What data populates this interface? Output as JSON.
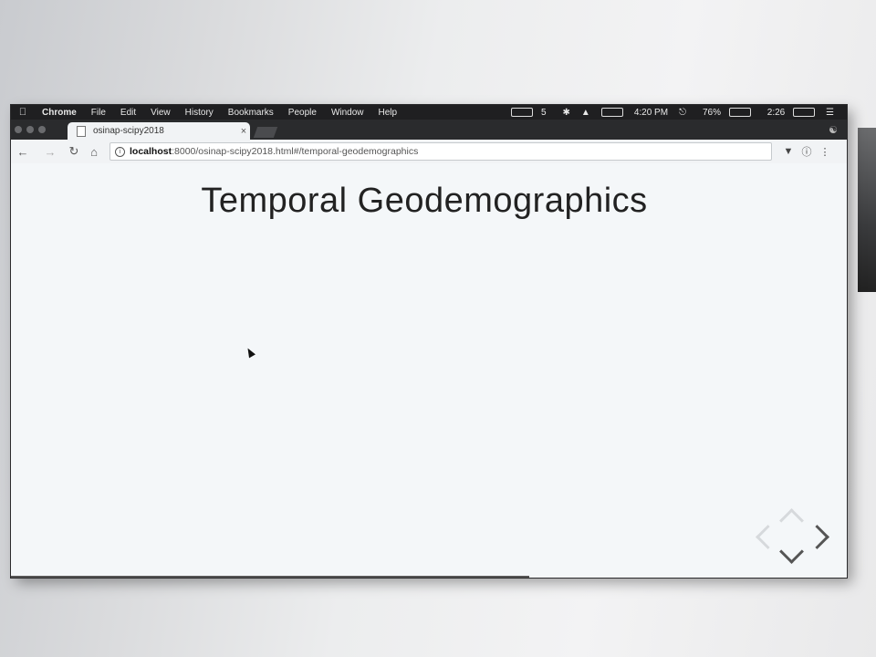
{
  "menubar": {
    "app": "Chrome",
    "items": [
      "File",
      "Edit",
      "View",
      "History",
      "Bookmarks",
      "People",
      "Window",
      "Help"
    ],
    "status": {
      "badge_count": "5",
      "time": "4:20 PM",
      "battery": "76%",
      "timer": "2:26"
    }
  },
  "tab": {
    "title": "osinap-scipy2018",
    "close": "×"
  },
  "toolbar": {
    "url_host": "localhost",
    "url_rest": ":8000/osinap-scipy2018.html#/temporal-geodemographics"
  },
  "slide": {
    "title": "Temporal Geodemographics",
    "progress": 0.62
  }
}
